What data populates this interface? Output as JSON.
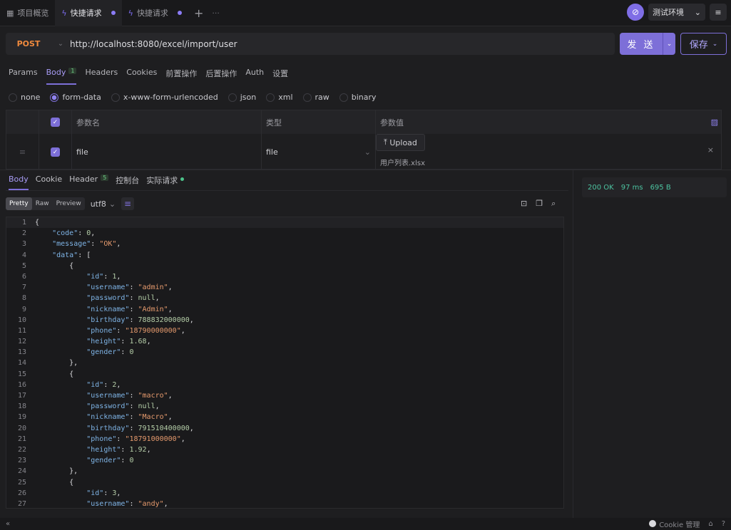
{
  "tabs": [
    {
      "label": "项目概览",
      "icon": "grid-icon",
      "active": false
    },
    {
      "label": "快捷请求",
      "icon": "bolt-icon",
      "active": true
    },
    {
      "label": "快捷请求",
      "icon": "bolt-icon",
      "active": false
    }
  ],
  "environment": {
    "label": "测试环境"
  },
  "request": {
    "method": "POST",
    "url": "http://localhost:8080/excel/import/user",
    "send_label": "发 送",
    "save_label": "保存"
  },
  "request_tabs": [
    {
      "label": "Params"
    },
    {
      "label": "Body",
      "badge": "1",
      "active": true
    },
    {
      "label": "Headers"
    },
    {
      "label": "Cookies"
    },
    {
      "label": "前置操作"
    },
    {
      "label": "后置操作"
    },
    {
      "label": "Auth"
    },
    {
      "label": "设置"
    }
  ],
  "body_types": [
    "none",
    "form-data",
    "x-www-form-urlencoded",
    "json",
    "xml",
    "raw",
    "binary"
  ],
  "body_type_selected": "form-data",
  "params_table": {
    "headers": {
      "name": "参数名",
      "type": "类型",
      "value": "参数值"
    },
    "rows": [
      {
        "name": "file",
        "type": "file",
        "upload_label": "Upload",
        "file_name": "用户列表.xlsx"
      }
    ]
  },
  "response_tabs": [
    {
      "label": "Body",
      "active": true
    },
    {
      "label": "Cookie"
    },
    {
      "label": "Header",
      "badge": "5"
    },
    {
      "label": "控制台"
    },
    {
      "label": "实际请求",
      "dot": true
    }
  ],
  "format": {
    "modes": [
      "Pretty",
      "Raw",
      "Preview"
    ],
    "selected": "Pretty",
    "encoding": "utf8"
  },
  "status": {
    "code": "200 OK",
    "time": "97 ms",
    "size": "695 B"
  },
  "code_lines": [
    "{",
    "    \"code\": 0,",
    "    \"message\": \"OK\",",
    "    \"data\": [",
    "        {",
    "            \"id\": 1,",
    "            \"username\": \"admin\",",
    "            \"password\": null,",
    "            \"nickname\": \"Admin\",",
    "            \"birthday\": 788832000000,",
    "            \"phone\": \"18790000000\",",
    "            \"height\": 1.68,",
    "            \"gender\": 0",
    "        },",
    "        {",
    "            \"id\": 2,",
    "            \"username\": \"macro\",",
    "            \"password\": null,",
    "            \"nickname\": \"Macro\",",
    "            \"birthday\": 791510400000,",
    "            \"phone\": \"18791000000\",",
    "            \"height\": 1.92,",
    "            \"gender\": 0",
    "        },",
    "        {",
    "            \"id\": 3,",
    "            \"username\": \"andy\","
  ],
  "bottom": {
    "cookie_label": "Cookie 管理"
  }
}
